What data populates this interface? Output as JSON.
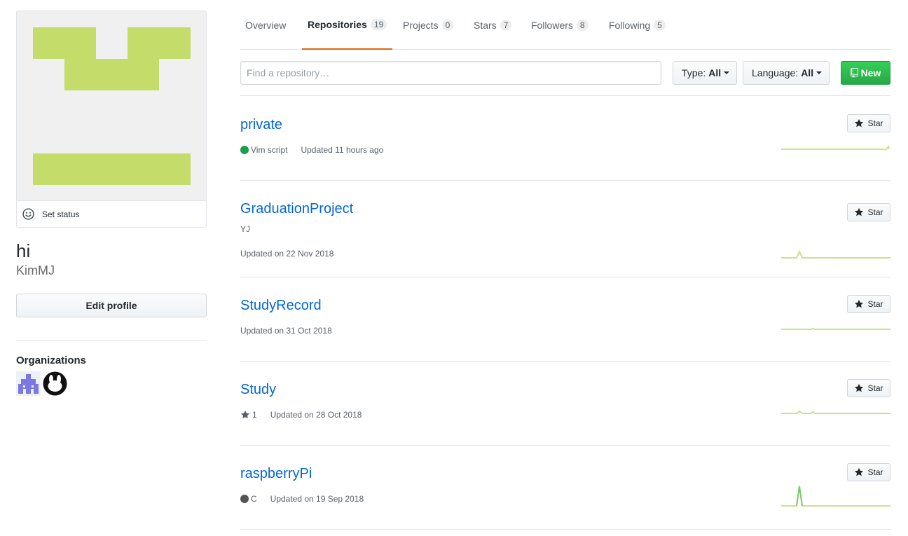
{
  "profile": {
    "fullname": "hi",
    "username": "KimMJ",
    "set_status_label": "Set status",
    "edit_profile_label": "Edit profile",
    "organizations_title": "Organizations",
    "avatar_color": "#c4dc69",
    "avatar_bg": "#f0f0f0"
  },
  "tabs": [
    {
      "label": "Overview",
      "count": ""
    },
    {
      "label": "Repositories",
      "count": "19"
    },
    {
      "label": "Projects",
      "count": "0"
    },
    {
      "label": "Stars",
      "count": "7"
    },
    {
      "label": "Followers",
      "count": "8"
    },
    {
      "label": "Following",
      "count": "5"
    }
  ],
  "filters": {
    "search_placeholder": "Find a repository…",
    "type_label": "Type:",
    "type_value": "All",
    "language_label": "Language:",
    "language_value": "All",
    "new_label": "New"
  },
  "star_button_label": "Star",
  "repos": [
    {
      "name": "private",
      "description": "",
      "language": "Vim script",
      "language_color": "#199f4b",
      "stars": "",
      "updated": "Updated 11 hours ago"
    },
    {
      "name": "GraduationProject",
      "description": "YJ",
      "language": "",
      "language_color": "",
      "stars": "",
      "updated": "Updated on 22 Nov 2018"
    },
    {
      "name": "StudyRecord",
      "description": "",
      "language": "",
      "language_color": "",
      "stars": "",
      "updated": "Updated on 31 Oct 2018"
    },
    {
      "name": "Study",
      "description": "",
      "language": "",
      "language_color": "",
      "stars": "1",
      "updated": "Updated on 28 Oct 2018"
    },
    {
      "name": "raspberryPi",
      "description": "",
      "language": "C",
      "language_color": "#555555",
      "stars": "",
      "updated": "Updated on 19 Sep 2018"
    }
  ],
  "colors": {
    "link": "#0366d6",
    "accent_tab": "#e36209",
    "new_button": "#28a745",
    "sparkline": "#c6e48b",
    "sparkline_peak": "#7bc96f"
  }
}
